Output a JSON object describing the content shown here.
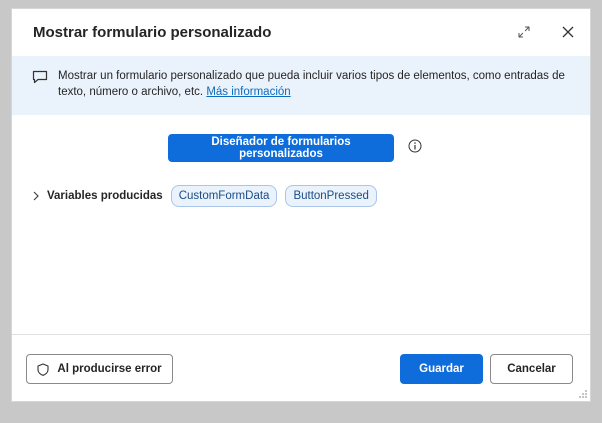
{
  "dialog": {
    "title": "Mostrar formulario personalizado",
    "controls": {
      "expand_icon": "expand-icon",
      "close_icon": "close-icon"
    }
  },
  "info": {
    "text": "Mostrar un formulario personalizado que pueda incluir varios tipos de elementos, como entradas de texto, número o archivo, etc.",
    "link_label": "Más información",
    "icon": "message-icon"
  },
  "designer": {
    "button_label": "Diseñador de formularios personalizados",
    "info_icon": "info-circle-icon"
  },
  "variables": {
    "label": "Variables producidas",
    "items": [
      "CustomFormData",
      "ButtonPressed"
    ]
  },
  "footer": {
    "error_label": "Al producirse error",
    "save_label": "Guardar",
    "cancel_label": "Cancelar"
  },
  "colors": {
    "accent": "#0f6cdb",
    "banner_bg": "#eaf2fc",
    "link": "#0f6cbd"
  }
}
